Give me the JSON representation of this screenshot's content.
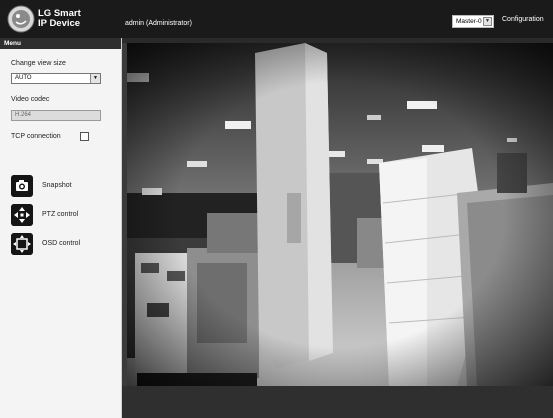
{
  "header": {
    "brand_line1": "LG Smart",
    "brand_line2": "IP Device",
    "user": "admin (Administrator)",
    "master_select": "Master-0",
    "config_link": "Configuration"
  },
  "sidebar": {
    "menu_title": "Menu",
    "view_size_label": "Change view size",
    "view_size_value": "AUTO",
    "codec_label": "Video codec",
    "codec_value": "H.264",
    "tcp_label": "TCP connection",
    "tools": [
      {
        "label": "Snapshot",
        "icon": "camera-icon"
      },
      {
        "label": "PTZ control",
        "icon": "ptz-arrows-icon"
      },
      {
        "label": "OSD control",
        "icon": "osd-icon"
      }
    ]
  },
  "colors": {
    "header_bg": "#1a1a1a",
    "sidebar_bg": "#f4f4f4",
    "video_frame_bg": "#3a3a3a"
  }
}
